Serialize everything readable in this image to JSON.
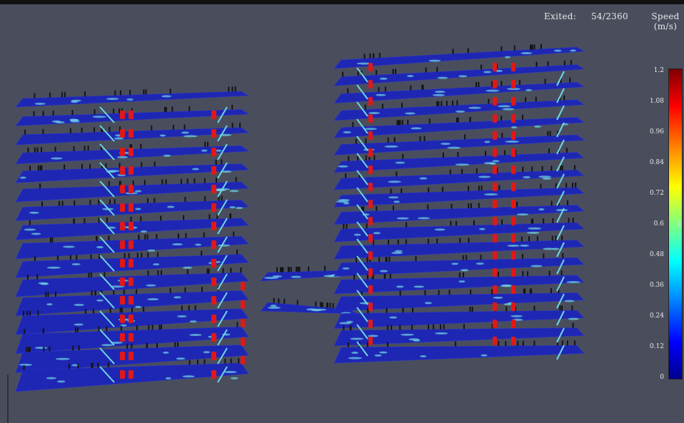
{
  "hud": {
    "exited_label": "Exited:",
    "exited_value": "54/2360",
    "speed_title_line1": "Speed",
    "speed_title_line2": "(m/s)"
  },
  "legend": {
    "ticks": [
      "1.2",
      "1.08",
      "0.96",
      "0.84",
      "0.72",
      "0.6",
      "0.48",
      "0.36",
      "0.24",
      "0.12",
      "0"
    ],
    "colors": [
      "#800000",
      "#ff0000",
      "#ff8000",
      "#ffff00",
      "#80ff80",
      "#00ffff",
      "#0080ff",
      "#0000ff",
      "#00008f"
    ]
  },
  "scene": {
    "floor_color": "#1c25b8",
    "stair_color": "#6fd6e6",
    "exit_marker_color": "#e01818",
    "agent_color": "#141414",
    "background": "#4a4e5c"
  },
  "controls": {
    "expand_icon": "chevron-right-icon"
  }
}
